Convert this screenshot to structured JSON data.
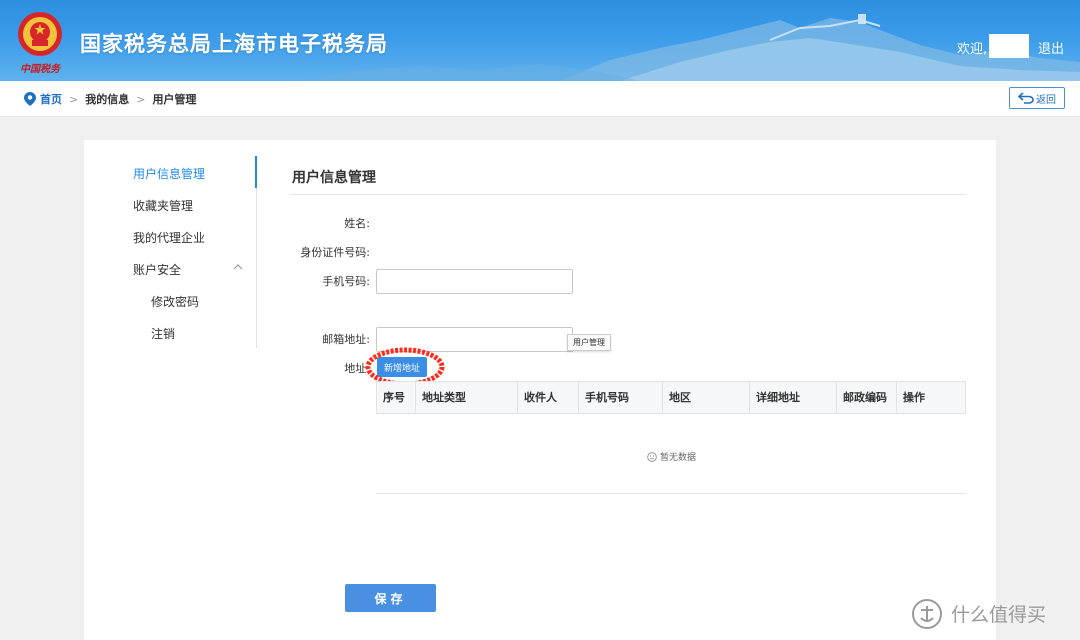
{
  "header": {
    "site_title": "国家税务总局上海市电子税务局",
    "emblem_text": "中国税务",
    "welcome": "欢迎,",
    "logout": "退出"
  },
  "breadcrumb": {
    "home": "首页",
    "sep": ">",
    "items": [
      "我的信息",
      "用户管理"
    ]
  },
  "back_button": "返回",
  "sidebar": {
    "items": [
      {
        "label": "用户信息管理",
        "active": true
      },
      {
        "label": "收藏夹管理"
      },
      {
        "label": "我的代理企业"
      },
      {
        "label": "账户安全",
        "expanded": true
      },
      {
        "label": "修改密码",
        "sub": true
      },
      {
        "label": "注销",
        "sub": true
      }
    ]
  },
  "section_title": "用户信息管理",
  "form": {
    "name_label": "姓名:",
    "id_label": "身份证件号码:",
    "phone_label": "手机号码:",
    "phone_value": "",
    "email_label": "邮箱地址:",
    "email_value": "",
    "address_label": "地址:",
    "tooltip": "用户管理",
    "add_address": "新增地址"
  },
  "table": {
    "columns": [
      "序号",
      "地址类型",
      "收件人",
      "手机号码",
      "地区",
      "详细地址",
      "邮政编码",
      "操作"
    ],
    "rows": [],
    "empty_text": "暂无数据"
  },
  "save_button": "保存",
  "watermark": "什么值得买",
  "colors": {
    "accent": "#1f8ce6",
    "header": "#3a9bea",
    "highlight": "#ff2a1a"
  }
}
